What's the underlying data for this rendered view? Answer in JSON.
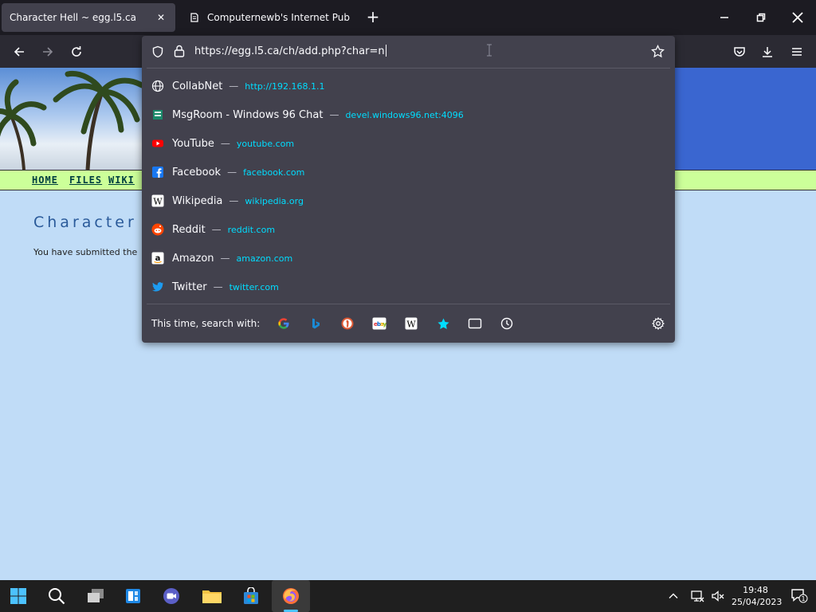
{
  "tabs": [
    {
      "title": "Character Hell ~ egg.l5.ca",
      "active": true
    },
    {
      "title": "Computernewb's Internet Pub",
      "active": false
    }
  ],
  "window_controls": [
    "minimize-icon",
    "restore-icon",
    "close-icon"
  ],
  "url_bar": {
    "value": "https://egg.l5.ca/ch/add.php?char=n"
  },
  "suggestions": [
    {
      "name": "CollabNet",
      "url": "http://192.168.1.1",
      "icon": "globe-icon"
    },
    {
      "name": "MsgRoom - Windows 96 Chat",
      "url": "devel.windows96.net:4096",
      "icon": "msgroom-icon"
    },
    {
      "name": "YouTube",
      "url": "youtube.com",
      "icon": "youtube-icon"
    },
    {
      "name": "Facebook",
      "url": "facebook.com",
      "icon": "facebook-icon"
    },
    {
      "name": "Wikipedia",
      "url": "wikipedia.org",
      "icon": "wikipedia-icon"
    },
    {
      "name": "Reddit",
      "url": "reddit.com",
      "icon": "reddit-icon"
    },
    {
      "name": "Amazon",
      "url": "amazon.com",
      "icon": "amazon-icon"
    },
    {
      "name": "Twitter",
      "url": "twitter.com",
      "icon": "twitter-icon"
    }
  ],
  "search_with_label": "This time, search with:",
  "search_engines": [
    "google-icon",
    "bing-icon",
    "duckduckgo-icon",
    "ebay-icon",
    "wikipedia-icon",
    "bookmarks-icon",
    "tabs-icon",
    "history-icon"
  ],
  "page": {
    "menu": [
      "HOME",
      "FILES",
      "WIKI"
    ],
    "title_partial": "Character s",
    "text_partial": "You have submitted the"
  },
  "taskbar": {
    "time": "19:48",
    "date": "25/04/2023",
    "notification_count": "1"
  },
  "colors": {
    "url_accent": "#00ddff",
    "panel_bg": "#42414d",
    "page_bg": "#c0dcf7",
    "menubar_bg": "#ccff99",
    "banner_bg": "#3a66d0"
  }
}
